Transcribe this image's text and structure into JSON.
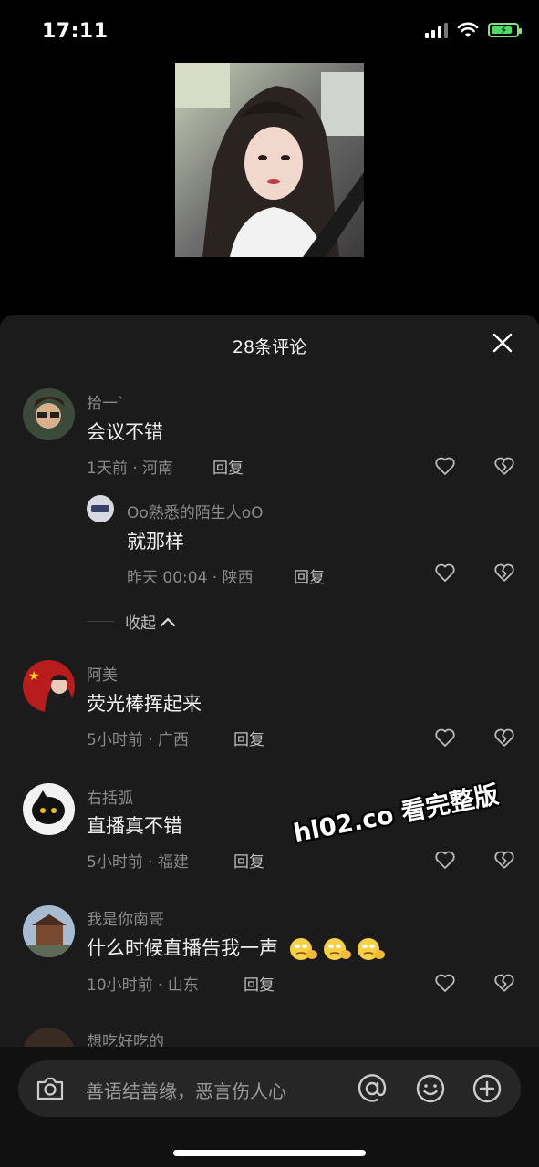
{
  "status_bar": {
    "time": "17:11"
  },
  "sheet": {
    "title": "28条评论"
  },
  "comments": [
    {
      "user": "拾一`",
      "text": "会议不错",
      "meta": "1天前 · 河南",
      "reply": "回复"
    },
    {
      "user": "Oo熟悉的陌生人oO",
      "text": "就那样",
      "meta": "昨天 00:04 · 陕西",
      "reply": "回复"
    },
    {
      "user": "阿美",
      "text": "荧光棒挥起来",
      "meta": "5小时前 · 广西",
      "reply": "回复"
    },
    {
      "user": "右括弧",
      "text": "直播真不错",
      "meta": "5小时前 · 福建",
      "reply": "回复"
    },
    {
      "user": "我是你南哥",
      "text": "什么时候直播告我一声",
      "meta": "10小时前 · 山东",
      "reply": "回复"
    },
    {
      "user": "想吃好吃的"
    }
  ],
  "collapse_label": "收起",
  "watermark": "hl02.co 看完整版",
  "input": {
    "placeholder": "善语结善缘，恶言伤人心"
  },
  "icons": {
    "close": "close-icon",
    "like": "heart-icon",
    "dislike": "broken-heart-icon",
    "camera": "camera-icon",
    "mention": "at-icon",
    "emoji": "smile-icon",
    "add": "plus-icon",
    "inline_emoji": "thinking-emoji"
  },
  "colors": {
    "background": "#000000",
    "sheet": "#1b1b1b",
    "muted_text": "#8a8a8a",
    "battery": "#4cd964"
  }
}
